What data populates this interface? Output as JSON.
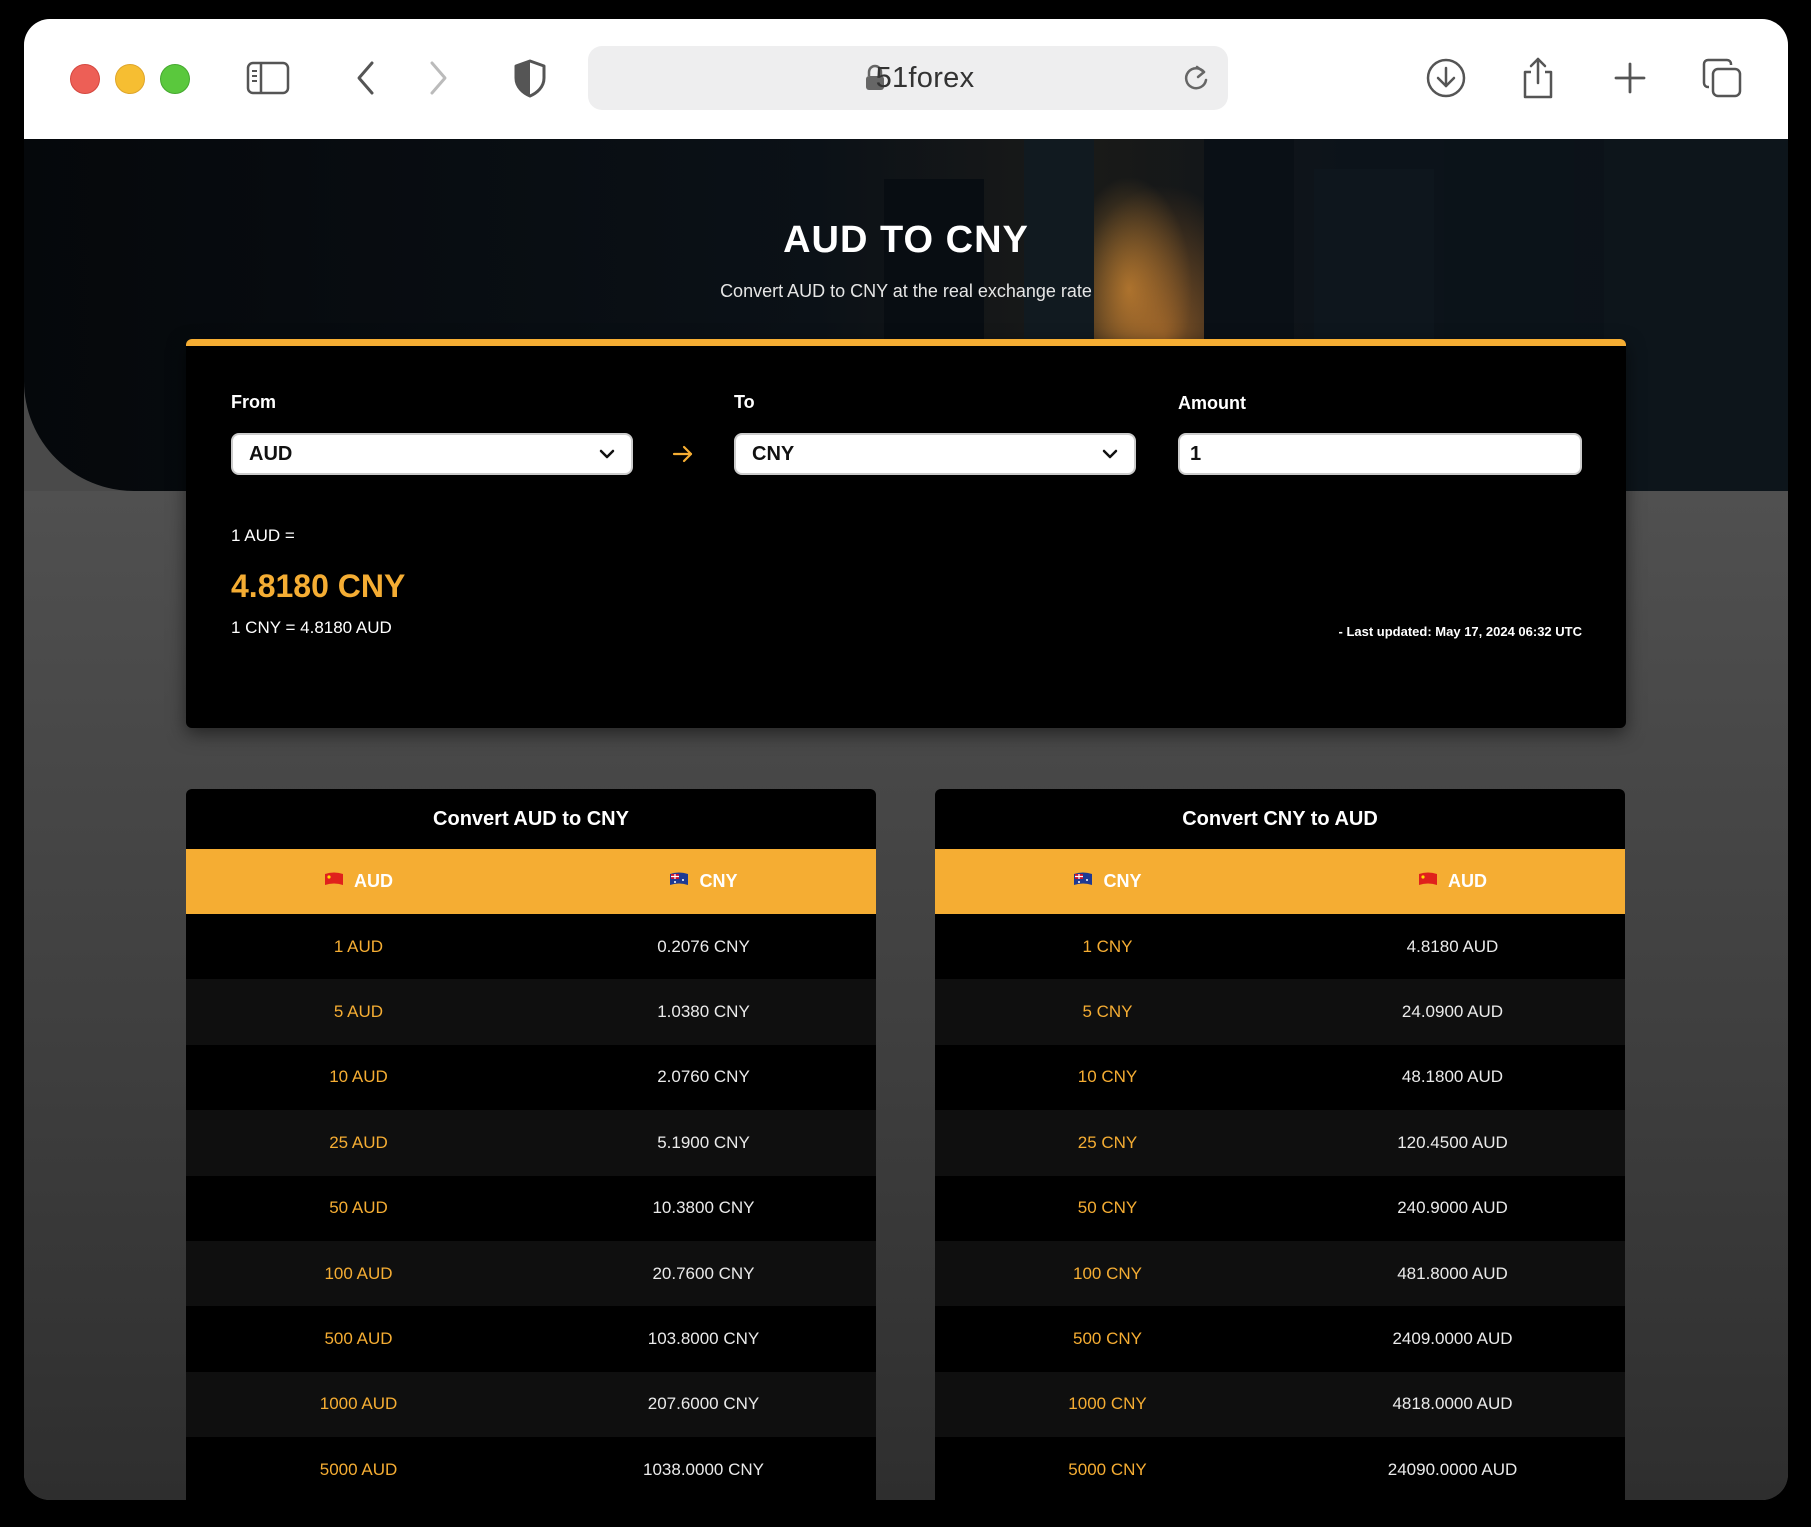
{
  "browser": {
    "url": "51forex"
  },
  "hero": {
    "title": "AUD TO CNY",
    "subtitle": "Convert AUD to CNY at the real exchange rate"
  },
  "converter": {
    "from_label": "From",
    "from_value": "AUD",
    "to_label": "To",
    "to_value": "CNY",
    "amount_label": "Amount",
    "amount_value": "1",
    "equation": "1 AUD =",
    "result": "4.8180 CNY",
    "inverse": "1 CNY = 4.8180 AUD",
    "last_updated": "- Last updated: May 17, 2024 06:32 UTC",
    "accent_color": "#f5ad33"
  },
  "tables": {
    "left": {
      "title": "Convert AUD to CNY",
      "headers": [
        "AUD",
        "CNY"
      ],
      "header_flags": [
        "china-flag-icon",
        "australia-flag-icon"
      ],
      "rows": [
        [
          "1 AUD",
          "0.2076 CNY"
        ],
        [
          "5 AUD",
          "1.0380 CNY"
        ],
        [
          "10 AUD",
          "2.0760 CNY"
        ],
        [
          "25 AUD",
          "5.1900 CNY"
        ],
        [
          "50 AUD",
          "10.3800 CNY"
        ],
        [
          "100 AUD",
          "20.7600 CNY"
        ],
        [
          "500 AUD",
          "103.8000 CNY"
        ],
        [
          "1000 AUD",
          "207.6000 CNY"
        ],
        [
          "5000 AUD",
          "1038.0000 CNY"
        ]
      ]
    },
    "right": {
      "title": "Convert CNY to AUD",
      "headers": [
        "CNY",
        "AUD"
      ],
      "header_flags": [
        "australia-flag-icon",
        "china-flag-icon"
      ],
      "rows": [
        [
          "1 CNY",
          "4.8180 AUD"
        ],
        [
          "5 CNY",
          "24.0900 AUD"
        ],
        [
          "10 CNY",
          "48.1800 AUD"
        ],
        [
          "25 CNY",
          "120.4500 AUD"
        ],
        [
          "50 CNY",
          "240.9000 AUD"
        ],
        [
          "100 CNY",
          "481.8000 AUD"
        ],
        [
          "500 CNY",
          "2409.0000 AUD"
        ],
        [
          "1000 CNY",
          "4818.0000 AUD"
        ],
        [
          "5000 CNY",
          "24090.0000 AUD"
        ]
      ]
    }
  }
}
